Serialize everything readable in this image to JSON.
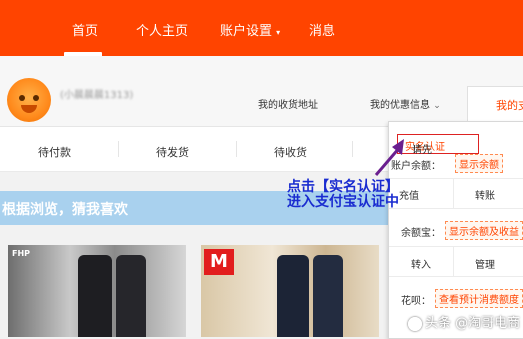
{
  "nav": {
    "items": [
      "首页",
      "个人主页",
      "账户设置",
      "消息"
    ],
    "active_index": 0,
    "brand_color": "#ff4400"
  },
  "profile": {
    "username": "(小晨晨晨1313)",
    "links": [
      "我的收货地址",
      "我的优惠信息"
    ],
    "active_tab": "我的支"
  },
  "orders": [
    "待付款",
    "待发货",
    "待收货"
  ],
  "recommend_title": "根据浏览，猜我喜欢",
  "products": [
    {
      "brand": "FHP"
    },
    {
      "brand": "M"
    }
  ],
  "panel": {
    "verify_prefix": "请先",
    "verify_link": "实名认证",
    "verify_suffix": "！",
    "balance_label": "账户余额：",
    "balance_action": "显示余额",
    "recharge": "充值",
    "transfer": "转账",
    "yuebao_label": "余额宝：",
    "yuebao_action": "显示余额及收益",
    "transfer_in": "转入",
    "manage": "管理",
    "huabei_label": "花呗：",
    "huabei_action": "查看预计消费额度"
  },
  "annotation": {
    "line1": "点击【实名认证】",
    "line2": "进入支付宝认证中",
    "color": "#1a2cd0"
  },
  "watermark": "头条 @淘哥电商"
}
